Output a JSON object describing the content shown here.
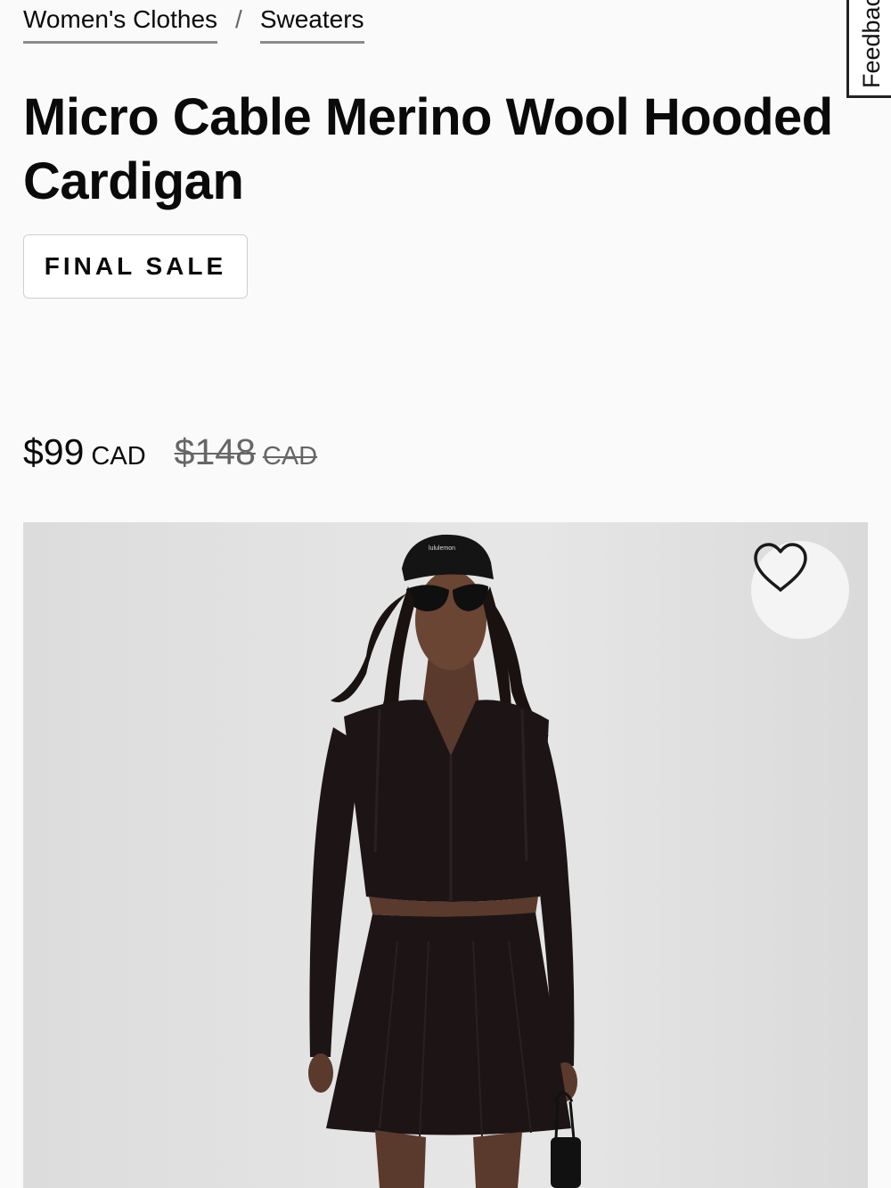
{
  "breadcrumb": {
    "items": [
      {
        "label": "Women's Clothes"
      },
      {
        "label": "Sweaters"
      }
    ],
    "separator": "/"
  },
  "feedback": {
    "label": "Feedback"
  },
  "product": {
    "title": "Micro Cable Merino Wool Hooded Cardigan",
    "badge": "FINAL SALE",
    "price": {
      "current": "$99",
      "current_currency": "CAD",
      "original": "$148",
      "original_currency": "CAD"
    },
    "image": {
      "cap_text": "lululemon",
      "wishlist_icon": "heart-outline-icon"
    }
  },
  "colors": {
    "background": "#fafafa",
    "text": "#0a0a0a",
    "muted": "#666666",
    "garment": "#1d1416",
    "image_bg": "#e2e2e2"
  }
}
